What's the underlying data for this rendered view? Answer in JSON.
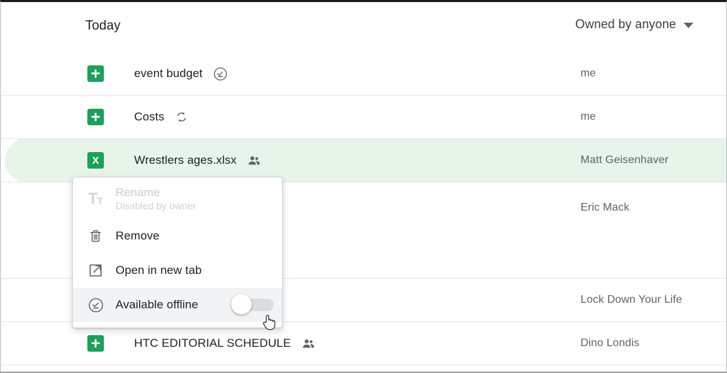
{
  "header": {
    "section_title": "Today",
    "owner_filter_label": "Owned by anyone",
    "owner_filter_caret_icon": "chevron-down-icon"
  },
  "files": [
    {
      "name": "event budget",
      "icon": "google-sheets-icon",
      "badge": "available-offline-icon",
      "owner": "me",
      "selected": false
    },
    {
      "name": "Costs",
      "icon": "google-sheets-icon",
      "badge": "sync-icon",
      "owner": "me",
      "selected": false
    },
    {
      "name": "Wrestlers ages.xlsx",
      "icon": "excel-xlsx-icon",
      "badge": "shared-people-icon",
      "owner": "Matt Geisenhaver",
      "selected": true
    },
    {
      "name": "",
      "icon": "",
      "badge": "",
      "owner": "Eric Mack",
      "selected": false
    },
    {
      "name": "",
      "icon": "",
      "badge": "",
      "owner": "Lock Down Your Life",
      "selected": false
    },
    {
      "name": "HTC EDITORIAL SCHEDULE",
      "icon": "google-sheets-icon",
      "badge": "shared-people-icon",
      "owner": "Dino Londis",
      "selected": false
    }
  ],
  "context_menu": {
    "items": [
      {
        "label": "Rename",
        "sublabel": "Disabled by owner",
        "icon": "text-format-icon",
        "disabled": true,
        "hovered": false
      },
      {
        "label": "Remove",
        "sublabel": "",
        "icon": "trash-icon",
        "disabled": false,
        "hovered": false
      },
      {
        "label": "Open in new tab",
        "sublabel": "",
        "icon": "open-in-new-tab-icon",
        "disabled": false,
        "hovered": false
      },
      {
        "label": "Available offline",
        "sublabel": "",
        "icon": "available-offline-icon",
        "disabled": false,
        "hovered": true,
        "toggle": {
          "state": "off"
        }
      }
    ]
  },
  "cursor": {
    "icon": "hand-pointer-cursor"
  },
  "colors": {
    "sheets_green": "#1ca05a",
    "selected_row": "#e6f4ea",
    "menu_hover": "#f1f3f4",
    "text_primary": "#202124",
    "text_secondary": "#5f6368",
    "divider": "#e4e6e8"
  }
}
